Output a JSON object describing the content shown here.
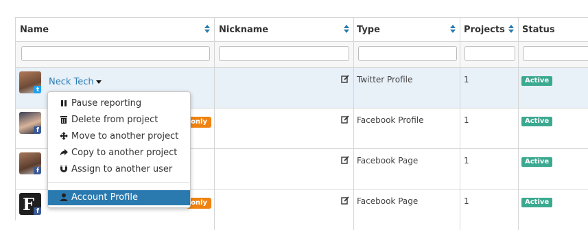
{
  "columns": {
    "name": "Name",
    "nickname": "Nickname",
    "type": "Type",
    "projects": "Projects",
    "status": "Status"
  },
  "rows": [
    {
      "name": "Neck Tech",
      "type": "Twitter Profile",
      "projects": "1",
      "status": "Active",
      "network": "twitter"
    },
    {
      "name": "",
      "type": "Facebook Profile",
      "projects": "1",
      "status": "Active",
      "network": "facebook",
      "badge": "only"
    },
    {
      "name": "",
      "type": "Facebook Page",
      "projects": "1",
      "status": "Active",
      "network": "facebook"
    },
    {
      "name": "",
      "type": "Facebook Page",
      "projects": "1",
      "status": "Active",
      "network": "facebook",
      "badge": "only"
    }
  ],
  "context_menu": {
    "items": [
      {
        "label": "Pause reporting",
        "icon": "pause-icon"
      },
      {
        "label": "Delete from project",
        "icon": "trash-icon"
      },
      {
        "label": "Move to another project",
        "icon": "move-arrows-icon"
      },
      {
        "label": "Copy to another project",
        "icon": "share-arrow-icon"
      },
      {
        "label": "Assign to another user",
        "icon": "magnet-icon"
      }
    ],
    "highlighted": {
      "label": "Account Profile",
      "icon": "user-icon"
    }
  },
  "colors": {
    "link": "#2a7ab0",
    "status_active": "#3aa98f",
    "only_badge": "#f0820f",
    "selected_row": "#e8f0f8",
    "twitter": "#1da1f2",
    "facebook": "#3b5998"
  }
}
